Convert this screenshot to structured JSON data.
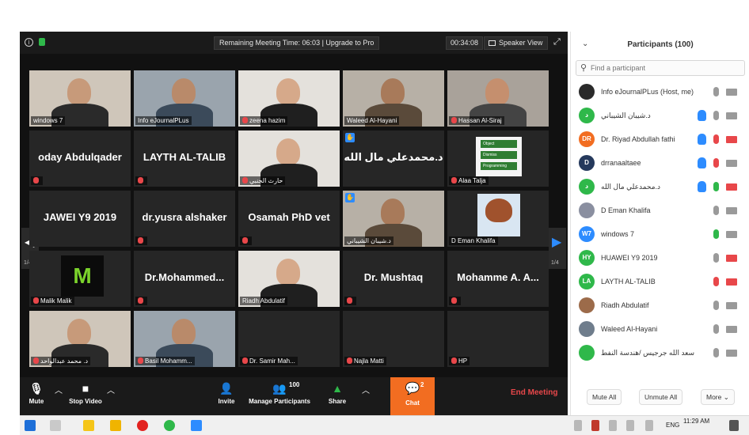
{
  "meeting": {
    "title_bar": {
      "remaining_text": "Remaining Meeting Time: 06:03 | Upgrade to Pro",
      "elapsed": "00:34:08",
      "view_label": "Speaker View"
    },
    "grid_tiles": [
      {
        "name": "windows 7",
        "display": "video",
        "muted": false,
        "active": true
      },
      {
        "name": "Info eJournalPLus",
        "display": "video",
        "muted": false
      },
      {
        "name": "zeena hazim",
        "display": "video",
        "muted": true
      },
      {
        "name": "Waleed Al-Hayani",
        "display": "video",
        "muted": false
      },
      {
        "name": "Hassan Al-Siraj",
        "display": "video",
        "muted": true
      },
      {
        "name": "oday Abdulqader",
        "display": "name",
        "muted": true
      },
      {
        "name": "LAYTH AL-TALIB",
        "display": "name",
        "muted": true
      },
      {
        "name": "حارث الجنبي",
        "display": "video",
        "muted": true
      },
      {
        "name": "د.محمدعلي مال الله",
        "display": "name",
        "muted": false,
        "hand": true
      },
      {
        "name": "Alaa Talja",
        "display": "slide",
        "muted": true
      },
      {
        "name": "JAWEI Y9 2019",
        "display": "name",
        "muted": false
      },
      {
        "name": "dr.yusra alshaker",
        "display": "name",
        "muted": true
      },
      {
        "name": "Osamah PhD vet",
        "display": "name",
        "muted": true
      },
      {
        "name": "د.شيبان الشيباني",
        "display": "video",
        "muted": false,
        "hand": true
      },
      {
        "name": "D Eman Khalifa",
        "display": "cartoon",
        "muted": false
      },
      {
        "name": "Malik Malik",
        "display": "logo",
        "muted": true
      },
      {
        "name": "Dr.Mohammed...",
        "display": "name",
        "muted": true
      },
      {
        "name": "Riadh Abdulatif",
        "display": "video",
        "muted": false
      },
      {
        "name": "Dr. Mushtaq",
        "display": "name",
        "muted": true
      },
      {
        "name": "Mohamme A. A...",
        "display": "name",
        "muted": true
      },
      {
        "name": "د. محمد عبدالواحد",
        "display": "video",
        "muted": true
      },
      {
        "name": "Basil Mohamm...",
        "display": "video",
        "muted": true
      },
      {
        "name": "Dr. Samir Mah...",
        "display": "blank",
        "muted": true
      },
      {
        "name": "Najla Matti",
        "display": "blank",
        "muted": true
      },
      {
        "name": "HP",
        "display": "blank",
        "muted": true
      }
    ],
    "slide_buttons": [
      "Object",
      "Dismiss",
      "Programming"
    ],
    "page_indicator": "1/4",
    "toolbar": {
      "mute": "Mute",
      "stop_video": "Stop Video",
      "invite": "Invite",
      "manage_participants": "Manage Participants",
      "participant_count": "100",
      "share": "Share",
      "chat": "Chat",
      "chat_count": "2",
      "end_meeting": "End Meeting"
    }
  },
  "panel": {
    "title": "Participants (100)",
    "search_placeholder": "Find a participant",
    "participants": [
      {
        "initials": "",
        "name": "Info eJournalPLus (Host, me)",
        "color": "#2a2a2a",
        "hand": false,
        "mic": "on-gray",
        "cam": "gray"
      },
      {
        "initials": "د",
        "name": "د.شيبان الشيباني",
        "color": "#2fb84a",
        "hand": true,
        "mic": "on-gray",
        "cam": "gray"
      },
      {
        "initials": "DR",
        "name": "Dr. Riyad Abdullah fathi",
        "color": "#f26d21",
        "hand": true,
        "mic": "off",
        "cam": "off"
      },
      {
        "initials": "D",
        "name": "drranaaltaee",
        "color": "#25395c",
        "hand": true,
        "mic": "off",
        "cam": "gray"
      },
      {
        "initials": "د",
        "name": "د.محمدعلي مال الله",
        "color": "#2fb84a",
        "hand": true,
        "mic": "on-green",
        "cam": "off"
      },
      {
        "initials": "",
        "name": "D Eman Khalifa",
        "color": "#8a8fa0",
        "hand": false,
        "mic": "on-gray",
        "cam": "gray"
      },
      {
        "initials": "W7",
        "name": "windows 7",
        "color": "#2d8cff",
        "hand": false,
        "mic": "on-green",
        "cam": "gray"
      },
      {
        "initials": "HY",
        "name": "HUAWEI Y9 2019",
        "color": "#2fb84a",
        "hand": false,
        "mic": "on-gray",
        "cam": "off"
      },
      {
        "initials": "LA",
        "name": "LAYTH AL-TALIB",
        "color": "#2fb84a",
        "hand": false,
        "mic": "off",
        "cam": "off"
      },
      {
        "initials": "",
        "name": "Riadh Abdulatif",
        "color": "#9c6b4a",
        "hand": false,
        "mic": "on-gray",
        "cam": "gray"
      },
      {
        "initials": "",
        "name": "Waleed Al-Hayani",
        "color": "#6f7d8c",
        "hand": false,
        "mic": "on-gray",
        "cam": "gray"
      },
      {
        "initials": "",
        "name": "حد سعد الله جرجيس /هندسة النفط",
        "color": "#2fb84a",
        "hand": false,
        "mic": "on-gray",
        "cam": "gray"
      }
    ],
    "footer": {
      "mute_all": "Mute All",
      "unmute_all": "Unmute All",
      "more": "More"
    }
  },
  "taskbar": {
    "language": "ENG",
    "time": "11:29 AM"
  }
}
